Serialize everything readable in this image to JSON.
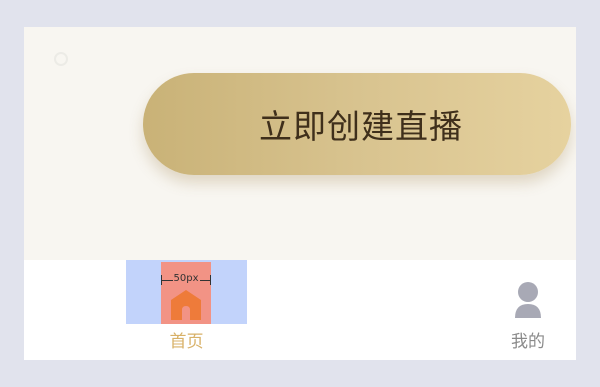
{
  "main": {
    "create_live_label": "立即创建直播"
  },
  "debug_overlay": {
    "measure_label": "50px"
  },
  "tabbar": {
    "tabs": [
      {
        "label": "首页",
        "icon": "home-icon",
        "active": true
      },
      {
        "label": "我的",
        "icon": "user-icon",
        "active": false
      }
    ]
  },
  "colors": {
    "active_tab": "#d8b168",
    "inactive_tab": "#8a8a8a",
    "button_text": "#3f2f1b",
    "button_gradient_start": "#c9b277",
    "button_gradient_end": "#e6d29f",
    "debug_outer": "#c2d3fb",
    "debug_inner": "#f29385",
    "icon_home": "#ee7b3a",
    "icon_user": "#a8a9b5"
  }
}
